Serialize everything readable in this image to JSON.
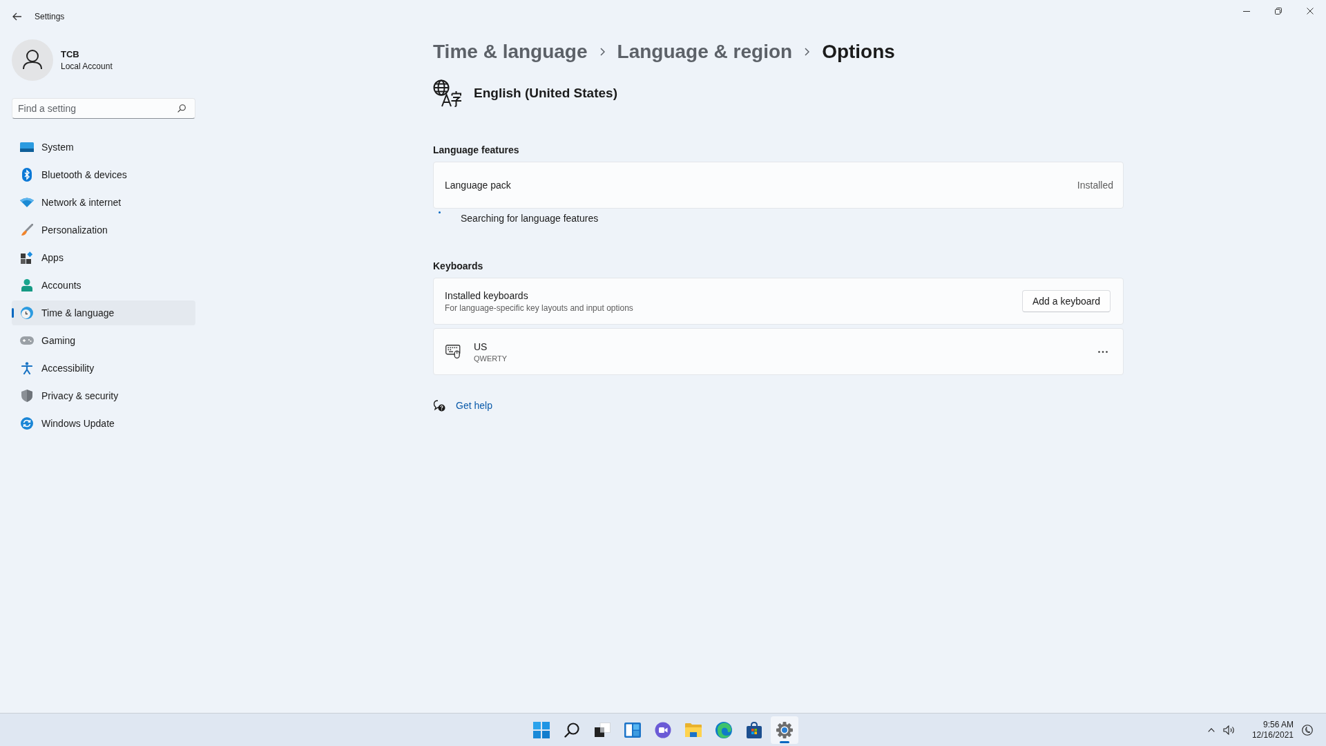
{
  "window": {
    "title": "Settings"
  },
  "account": {
    "name": "TCB",
    "type": "Local Account"
  },
  "search": {
    "placeholder": "Find a setting"
  },
  "sidebar": {
    "items": [
      {
        "label": "System",
        "selected": false
      },
      {
        "label": "Bluetooth & devices",
        "selected": false
      },
      {
        "label": "Network & internet",
        "selected": false
      },
      {
        "label": "Personalization",
        "selected": false
      },
      {
        "label": "Apps",
        "selected": false
      },
      {
        "label": "Accounts",
        "selected": false
      },
      {
        "label": "Time & language",
        "selected": true
      },
      {
        "label": "Gaming",
        "selected": false
      },
      {
        "label": "Accessibility",
        "selected": false
      },
      {
        "label": "Privacy & security",
        "selected": false
      },
      {
        "label": "Windows Update",
        "selected": false
      }
    ]
  },
  "breadcrumb": [
    {
      "label": "Time & language",
      "current": false
    },
    {
      "label": "Language & region",
      "current": false
    },
    {
      "label": "Options",
      "current": true
    }
  ],
  "language": {
    "name": "English (United States)"
  },
  "language_features": {
    "heading": "Language features",
    "language_pack": {
      "label": "Language pack",
      "status": "Installed"
    },
    "status_message": "Searching for language features"
  },
  "keyboards": {
    "heading": "Keyboards",
    "installed": {
      "title": "Installed keyboards",
      "description": "For language-specific key layouts and input options",
      "button": "Add a keyboard"
    },
    "items": [
      {
        "name": "US",
        "layout": "QWERTY"
      }
    ]
  },
  "help_link": {
    "label": "Get help"
  },
  "taskbar": {
    "apps": [
      {
        "selected": false
      },
      {
        "selected": false
      },
      {
        "selected": false
      },
      {
        "selected": false
      },
      {
        "selected": false
      },
      {
        "selected": false
      },
      {
        "selected": false
      },
      {
        "selected": false
      },
      {
        "selected": true
      }
    ],
    "clock": {
      "time": "9:56 AM",
      "date": "12/16/2021"
    }
  }
}
